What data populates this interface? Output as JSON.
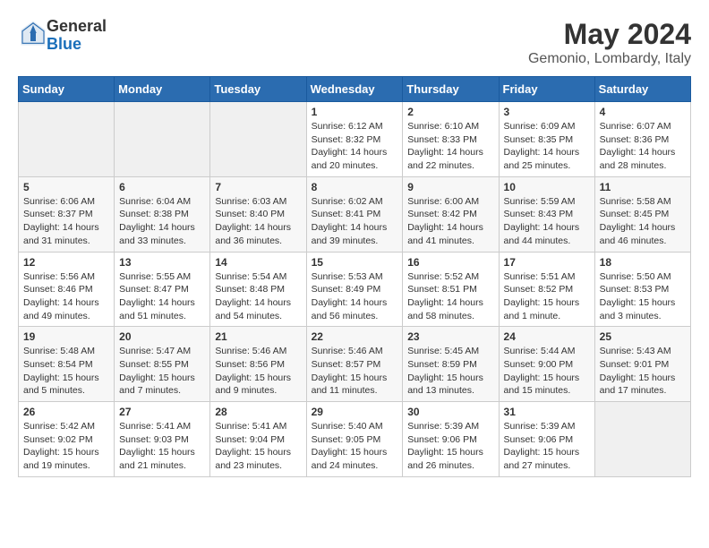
{
  "header": {
    "logo_general": "General",
    "logo_blue": "Blue",
    "month_title": "May 2024",
    "location": "Gemonio, Lombardy, Italy"
  },
  "weekdays": [
    "Sunday",
    "Monday",
    "Tuesday",
    "Wednesday",
    "Thursday",
    "Friday",
    "Saturday"
  ],
  "weeks": [
    [
      {
        "day": "",
        "info": ""
      },
      {
        "day": "",
        "info": ""
      },
      {
        "day": "",
        "info": ""
      },
      {
        "day": "1",
        "info": "Sunrise: 6:12 AM\nSunset: 8:32 PM\nDaylight: 14 hours\nand 20 minutes."
      },
      {
        "day": "2",
        "info": "Sunrise: 6:10 AM\nSunset: 8:33 PM\nDaylight: 14 hours\nand 22 minutes."
      },
      {
        "day": "3",
        "info": "Sunrise: 6:09 AM\nSunset: 8:35 PM\nDaylight: 14 hours\nand 25 minutes."
      },
      {
        "day": "4",
        "info": "Sunrise: 6:07 AM\nSunset: 8:36 PM\nDaylight: 14 hours\nand 28 minutes."
      }
    ],
    [
      {
        "day": "5",
        "info": "Sunrise: 6:06 AM\nSunset: 8:37 PM\nDaylight: 14 hours\nand 31 minutes."
      },
      {
        "day": "6",
        "info": "Sunrise: 6:04 AM\nSunset: 8:38 PM\nDaylight: 14 hours\nand 33 minutes."
      },
      {
        "day": "7",
        "info": "Sunrise: 6:03 AM\nSunset: 8:40 PM\nDaylight: 14 hours\nand 36 minutes."
      },
      {
        "day": "8",
        "info": "Sunrise: 6:02 AM\nSunset: 8:41 PM\nDaylight: 14 hours\nand 39 minutes."
      },
      {
        "day": "9",
        "info": "Sunrise: 6:00 AM\nSunset: 8:42 PM\nDaylight: 14 hours\nand 41 minutes."
      },
      {
        "day": "10",
        "info": "Sunrise: 5:59 AM\nSunset: 8:43 PM\nDaylight: 14 hours\nand 44 minutes."
      },
      {
        "day": "11",
        "info": "Sunrise: 5:58 AM\nSunset: 8:45 PM\nDaylight: 14 hours\nand 46 minutes."
      }
    ],
    [
      {
        "day": "12",
        "info": "Sunrise: 5:56 AM\nSunset: 8:46 PM\nDaylight: 14 hours\nand 49 minutes."
      },
      {
        "day": "13",
        "info": "Sunrise: 5:55 AM\nSunset: 8:47 PM\nDaylight: 14 hours\nand 51 minutes."
      },
      {
        "day": "14",
        "info": "Sunrise: 5:54 AM\nSunset: 8:48 PM\nDaylight: 14 hours\nand 54 minutes."
      },
      {
        "day": "15",
        "info": "Sunrise: 5:53 AM\nSunset: 8:49 PM\nDaylight: 14 hours\nand 56 minutes."
      },
      {
        "day": "16",
        "info": "Sunrise: 5:52 AM\nSunset: 8:51 PM\nDaylight: 14 hours\nand 58 minutes."
      },
      {
        "day": "17",
        "info": "Sunrise: 5:51 AM\nSunset: 8:52 PM\nDaylight: 15 hours\nand 1 minute."
      },
      {
        "day": "18",
        "info": "Sunrise: 5:50 AM\nSunset: 8:53 PM\nDaylight: 15 hours\nand 3 minutes."
      }
    ],
    [
      {
        "day": "19",
        "info": "Sunrise: 5:48 AM\nSunset: 8:54 PM\nDaylight: 15 hours\nand 5 minutes."
      },
      {
        "day": "20",
        "info": "Sunrise: 5:47 AM\nSunset: 8:55 PM\nDaylight: 15 hours\nand 7 minutes."
      },
      {
        "day": "21",
        "info": "Sunrise: 5:46 AM\nSunset: 8:56 PM\nDaylight: 15 hours\nand 9 minutes."
      },
      {
        "day": "22",
        "info": "Sunrise: 5:46 AM\nSunset: 8:57 PM\nDaylight: 15 hours\nand 11 minutes."
      },
      {
        "day": "23",
        "info": "Sunrise: 5:45 AM\nSunset: 8:59 PM\nDaylight: 15 hours\nand 13 minutes."
      },
      {
        "day": "24",
        "info": "Sunrise: 5:44 AM\nSunset: 9:00 PM\nDaylight: 15 hours\nand 15 minutes."
      },
      {
        "day": "25",
        "info": "Sunrise: 5:43 AM\nSunset: 9:01 PM\nDaylight: 15 hours\nand 17 minutes."
      }
    ],
    [
      {
        "day": "26",
        "info": "Sunrise: 5:42 AM\nSunset: 9:02 PM\nDaylight: 15 hours\nand 19 minutes."
      },
      {
        "day": "27",
        "info": "Sunrise: 5:41 AM\nSunset: 9:03 PM\nDaylight: 15 hours\nand 21 minutes."
      },
      {
        "day": "28",
        "info": "Sunrise: 5:41 AM\nSunset: 9:04 PM\nDaylight: 15 hours\nand 23 minutes."
      },
      {
        "day": "29",
        "info": "Sunrise: 5:40 AM\nSunset: 9:05 PM\nDaylight: 15 hours\nand 24 minutes."
      },
      {
        "day": "30",
        "info": "Sunrise: 5:39 AM\nSunset: 9:06 PM\nDaylight: 15 hours\nand 26 minutes."
      },
      {
        "day": "31",
        "info": "Sunrise: 5:39 AM\nSunset: 9:06 PM\nDaylight: 15 hours\nand 27 minutes."
      },
      {
        "day": "",
        "info": ""
      }
    ]
  ]
}
